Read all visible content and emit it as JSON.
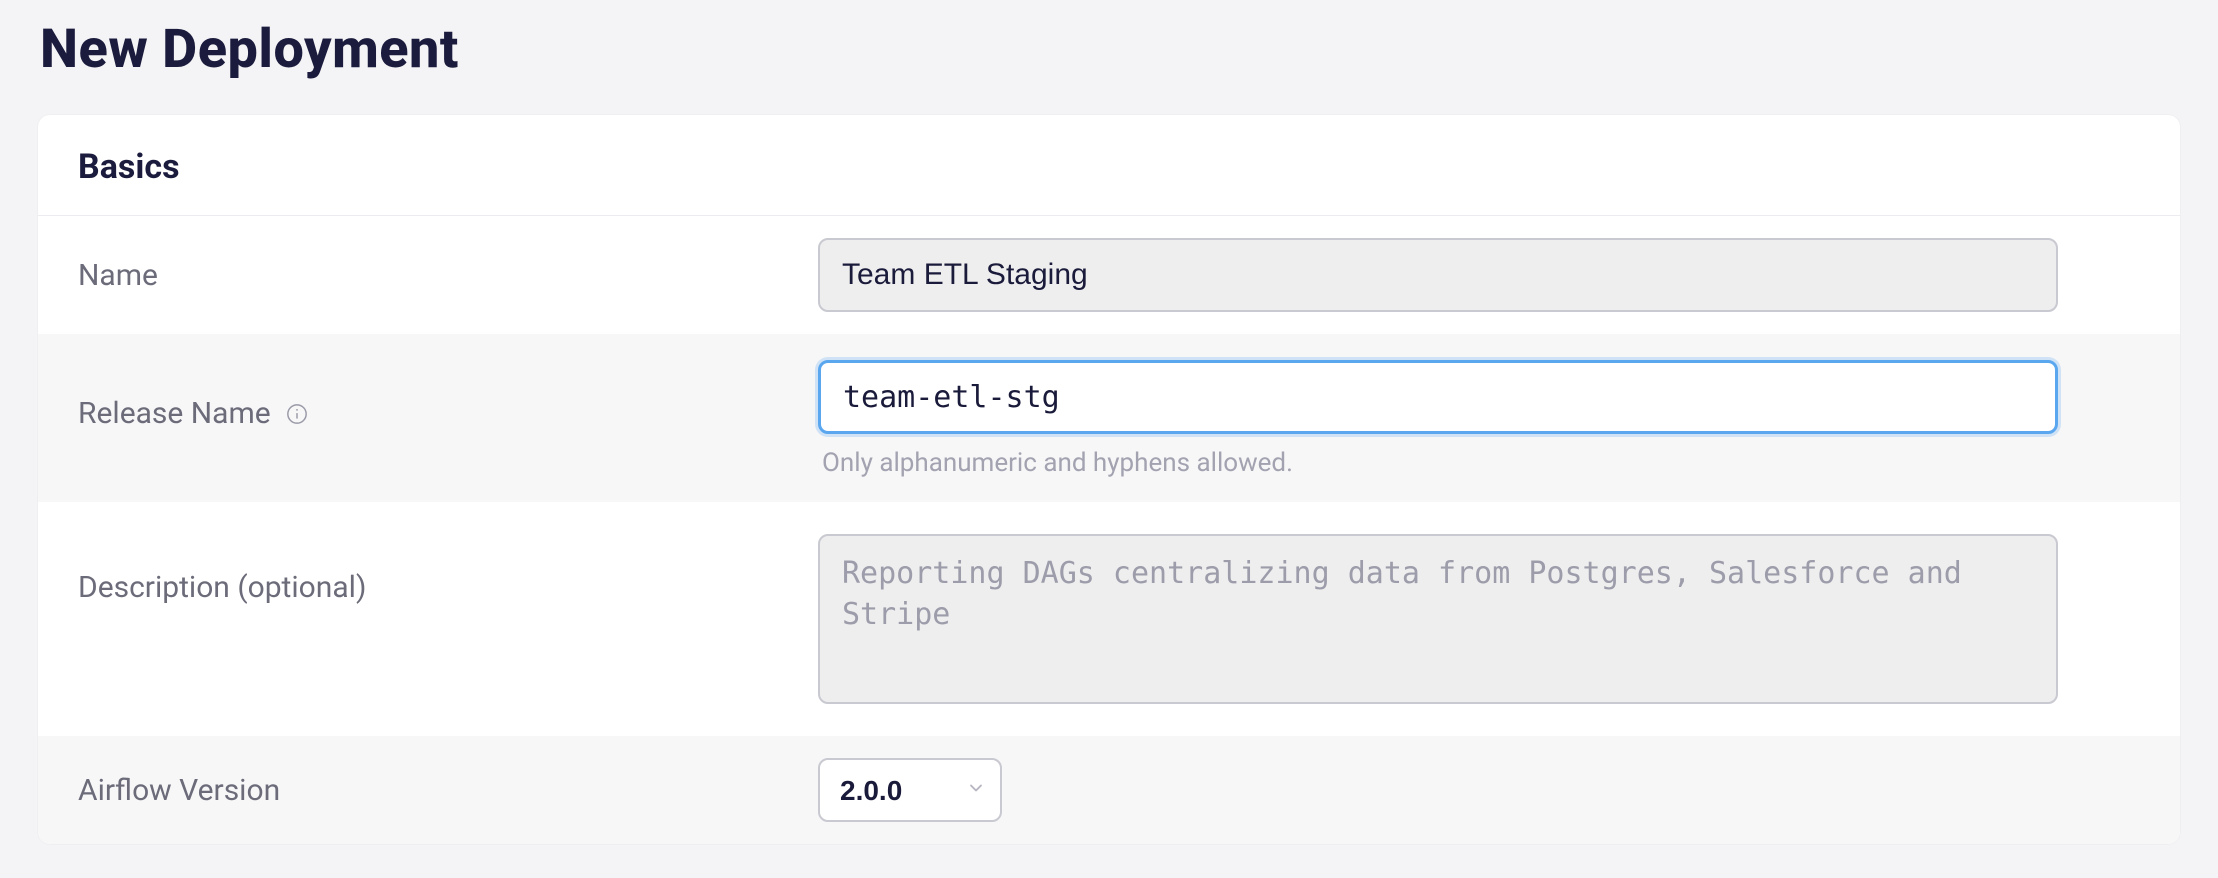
{
  "page": {
    "title": "New Deployment"
  },
  "section": {
    "basics_heading": "Basics"
  },
  "fields": {
    "name": {
      "label": "Name",
      "value": "Team ETL Staging"
    },
    "release_name": {
      "label": "Release Name",
      "value": "team-etl-stg",
      "helper": "Only alphanumeric and hyphens allowed.",
      "info_icon": "info-icon"
    },
    "description": {
      "label": "Description (optional)",
      "placeholder": "Reporting DAGs centralizing data from Postgres, Salesforce and Stripe"
    },
    "airflow_version": {
      "label": "Airflow Version",
      "value": "2.0.0"
    }
  }
}
